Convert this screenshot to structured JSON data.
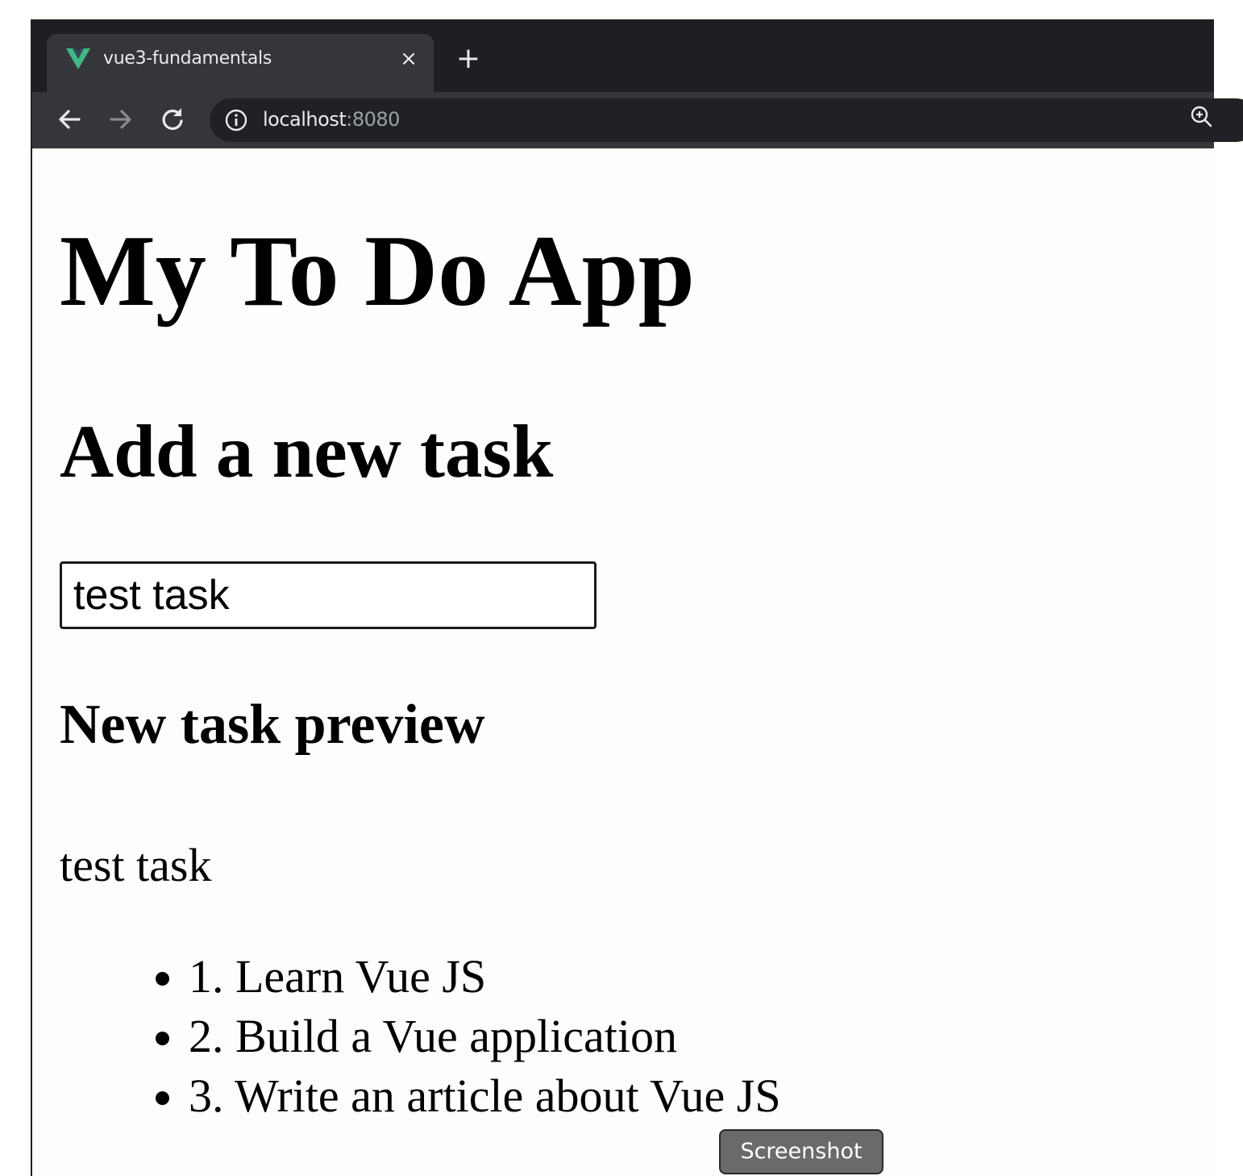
{
  "browser": {
    "tab_title": "vue3-fundamentals",
    "tab_close_glyph": "×",
    "new_tab_glyph": "+",
    "url_host": "localhost",
    "url_port": ":8080",
    "icons": {
      "favicon": "vue-logo-icon",
      "back": "back-arrow-icon",
      "forward": "forward-arrow-icon",
      "reload": "reload-icon",
      "site_info": "info-icon",
      "zoom": "zoom-in-icon"
    },
    "colors": {
      "frame": "#1e1f23",
      "toolbar": "#35363a",
      "omnibox": "#202124",
      "vue_green": "#41b883"
    }
  },
  "page": {
    "title": "My To Do App",
    "add_heading": "Add a new task",
    "input_value": "test task",
    "preview_heading": "New task preview",
    "preview_text": "test task",
    "tasks": [
      "1. Learn Vue JS",
      "2. Build a Vue application",
      "3. Write an article about Vue JS"
    ]
  },
  "overlay": {
    "tooltip": "Screenshot"
  }
}
